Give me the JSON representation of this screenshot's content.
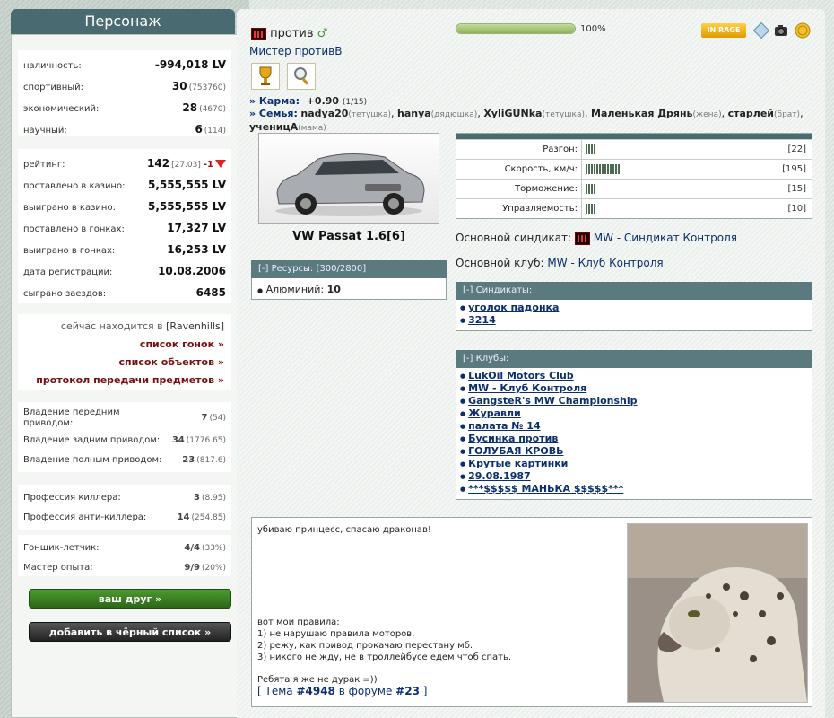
{
  "left": {
    "title": "Персонаж",
    "money": [
      {
        "label": "наличность:",
        "value": "-994,018 LV",
        "extra": ""
      },
      {
        "label": "спортивный:",
        "value": "30",
        "extra": "(753760)"
      },
      {
        "label": "экономический:",
        "value": "28",
        "extra": "(4670)"
      },
      {
        "label": "научный:",
        "value": "6",
        "extra": "(114)"
      }
    ],
    "rating": {
      "label": "рейтинг:",
      "value": "142",
      "extra": "[27.03]",
      "delta": "-1"
    },
    "stats": [
      {
        "label": "поставлено в казино:",
        "value": "5,555,555 LV"
      },
      {
        "label": "выиграно в казино:",
        "value": "5,555,555 LV"
      },
      {
        "label": "поставлено в гонках:",
        "value": "17,327 LV"
      },
      {
        "label": "выиграно в гонках:",
        "value": "16,253 LV"
      },
      {
        "label": "дата регистрации:",
        "value": "10.08.2006"
      },
      {
        "label": "сыграно заездов:",
        "value": "6485"
      }
    ],
    "location_prefix": "сейчас находится в ",
    "location_city": "[Ravenhills]",
    "links": [
      "список гонок »",
      "список объектов »",
      "протокол передачи предметов »"
    ],
    "drive": [
      {
        "label": "Владение передним приводом:",
        "value": "7",
        "extra": "(54)"
      },
      {
        "label": "Владение задним приводом:",
        "value": "34",
        "extra": "(1776.65)"
      },
      {
        "label": "Владение полным приводом:",
        "value": "23",
        "extra": "(817.6)"
      }
    ],
    "profession": [
      {
        "label": "Профессия киллера:",
        "value": "3",
        "extra": "(8.95)"
      },
      {
        "label": "Профессия анти-киллера:",
        "value": "14",
        "extra": "(254.85)"
      }
    ],
    "achievements": [
      {
        "label": "Гонщик-летчик:",
        "value": "4/4",
        "extra": "(33%)"
      },
      {
        "label": "Мастер опыта:",
        "value": "9/9",
        "extra": "(20%)"
      }
    ],
    "friend_button": "ваш друг »",
    "blacklist_button": "добавить в чёрный список »"
  },
  "profile": {
    "nick": "против",
    "gender_symbol": "♂",
    "title": "Мистер противВ",
    "progress_percent": 100,
    "progress_label": "100%",
    "rage_badge": "IN RAGE",
    "karma_label": "» Карма:",
    "karma_value": "+0.90",
    "karma_extra": "(1/15)",
    "family_label": "» Семья:",
    "family": [
      {
        "name": "nadya20",
        "role": "(тетушка)"
      },
      {
        "name": "hanya",
        "role": "(дядюшка)"
      },
      {
        "name": "XyliGUNka",
        "role": "(тетушка)"
      },
      {
        "name": "Маленькая Дрянь",
        "role": "(жена)"
      },
      {
        "name": "старлей",
        "role": "(брат)"
      },
      {
        "name": "ученицА",
        "role": "(мама)"
      }
    ]
  },
  "car": {
    "name": "VW Passat 1.6[6]",
    "stats": [
      {
        "label": "Разгон:",
        "level": 22,
        "value": "[22]"
      },
      {
        "label": "Скорость, км/ч:",
        "level": 195,
        "value": "[195]"
      },
      {
        "label": "Торможение:",
        "level": 15,
        "value": "[15]"
      },
      {
        "label": "Управляемость:",
        "level": 10,
        "value": "[10]"
      }
    ]
  },
  "resources": {
    "header": "[-]  Ресурсы: [300/2800]",
    "items": [
      {
        "name": "Алюминий:",
        "value": "10"
      }
    ]
  },
  "syndicate": {
    "label": "Основной синдикат:",
    "name": "MW - Синдикат Контроля"
  },
  "club": {
    "label": "Основной клуб:",
    "name": "MW - Клуб Контроля"
  },
  "syndicates": {
    "header": "[-]  Синдикаты:",
    "items": [
      "уголок падонка",
      "3214"
    ]
  },
  "clubs": {
    "header": "[-]  Клубы:",
    "items": [
      "LukOil Motors Club",
      "MW - Клуб Контроля",
      "GangsteR's MW Championship",
      "Журавли",
      "палата № 14",
      "Бусинка против",
      "ГОЛУБАЯ КРОВЬ",
      "Крутые картинки",
      "29.08.1987",
      "***$$$$$ МАНЬКА $$$$$***"
    ]
  },
  "about": {
    "line1": "убиваю принцесс, спасаю драконав!",
    "rules_title": "вот мои правила:",
    "rules": [
      "1) не нарушаю правила моторов.",
      "2) режу, как привод прокачаю перестану мб.",
      "3) никого не жду, не в троллейбусе едем чтоб спать."
    ],
    "closing": "Ребята я же не дурак =))",
    "forum_prefix": "[ Тема ",
    "forum_topic": "#4948",
    "forum_mid": " в форуме ",
    "forum_num": "#23",
    "forum_suffix": " ]"
  }
}
